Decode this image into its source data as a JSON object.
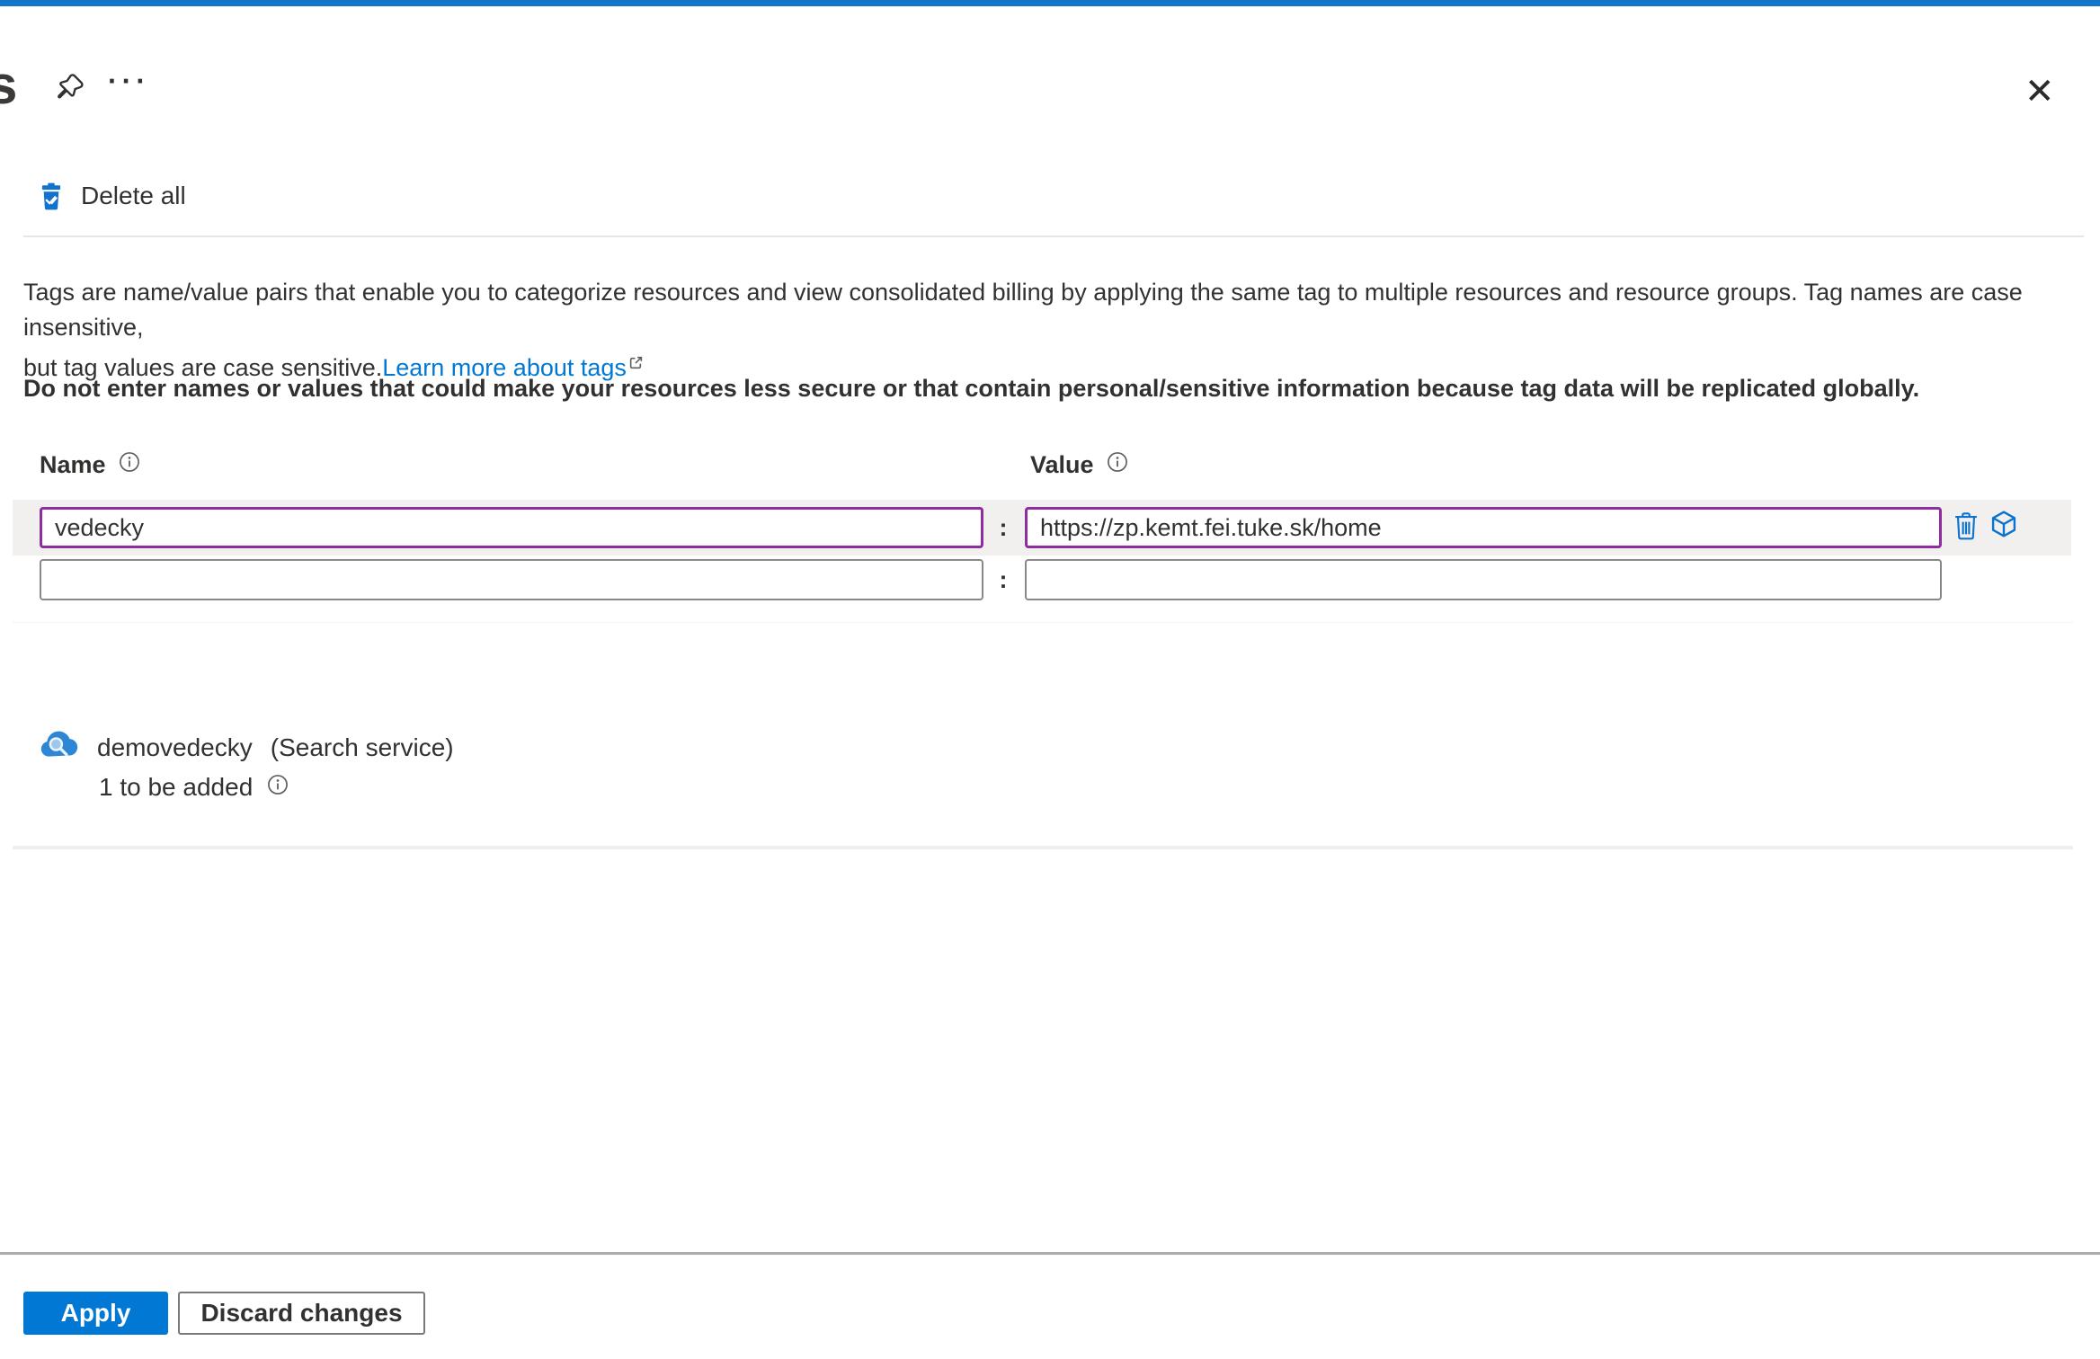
{
  "header": {
    "title_partial": "s",
    "more_glyph": "···",
    "close_glyph": "✕"
  },
  "toolbar": {
    "delete_all_label": "Delete all"
  },
  "description": {
    "line1": "Tags are name/value pairs that enable you to categorize resources and view consolidated billing by applying the same tag to multiple resources and resource groups. Tag names are case insensitive,",
    "line2": "but tag values are case sensitive.",
    "link_label": "Learn more about tags",
    "warning": "Do not enter names or values that could make your resources less secure or that contain personal/sensitive information because tag data will be replicated globally."
  },
  "tags_table": {
    "name_header": "Name",
    "value_header": "Value",
    "separator": ":",
    "rows": [
      {
        "name": "vedecky",
        "value": "https://zp.kemt.fei.tuke.sk/home"
      },
      {
        "name": "",
        "value": ""
      }
    ]
  },
  "resource": {
    "name": "demovedecky",
    "type": "(Search service)",
    "status": "1 to be added"
  },
  "footer": {
    "apply_label": "Apply",
    "discard_label": "Discard changes"
  },
  "colors": {
    "accent": "#0078d4",
    "modified_border": "#8f2da0",
    "text": "#323130"
  }
}
